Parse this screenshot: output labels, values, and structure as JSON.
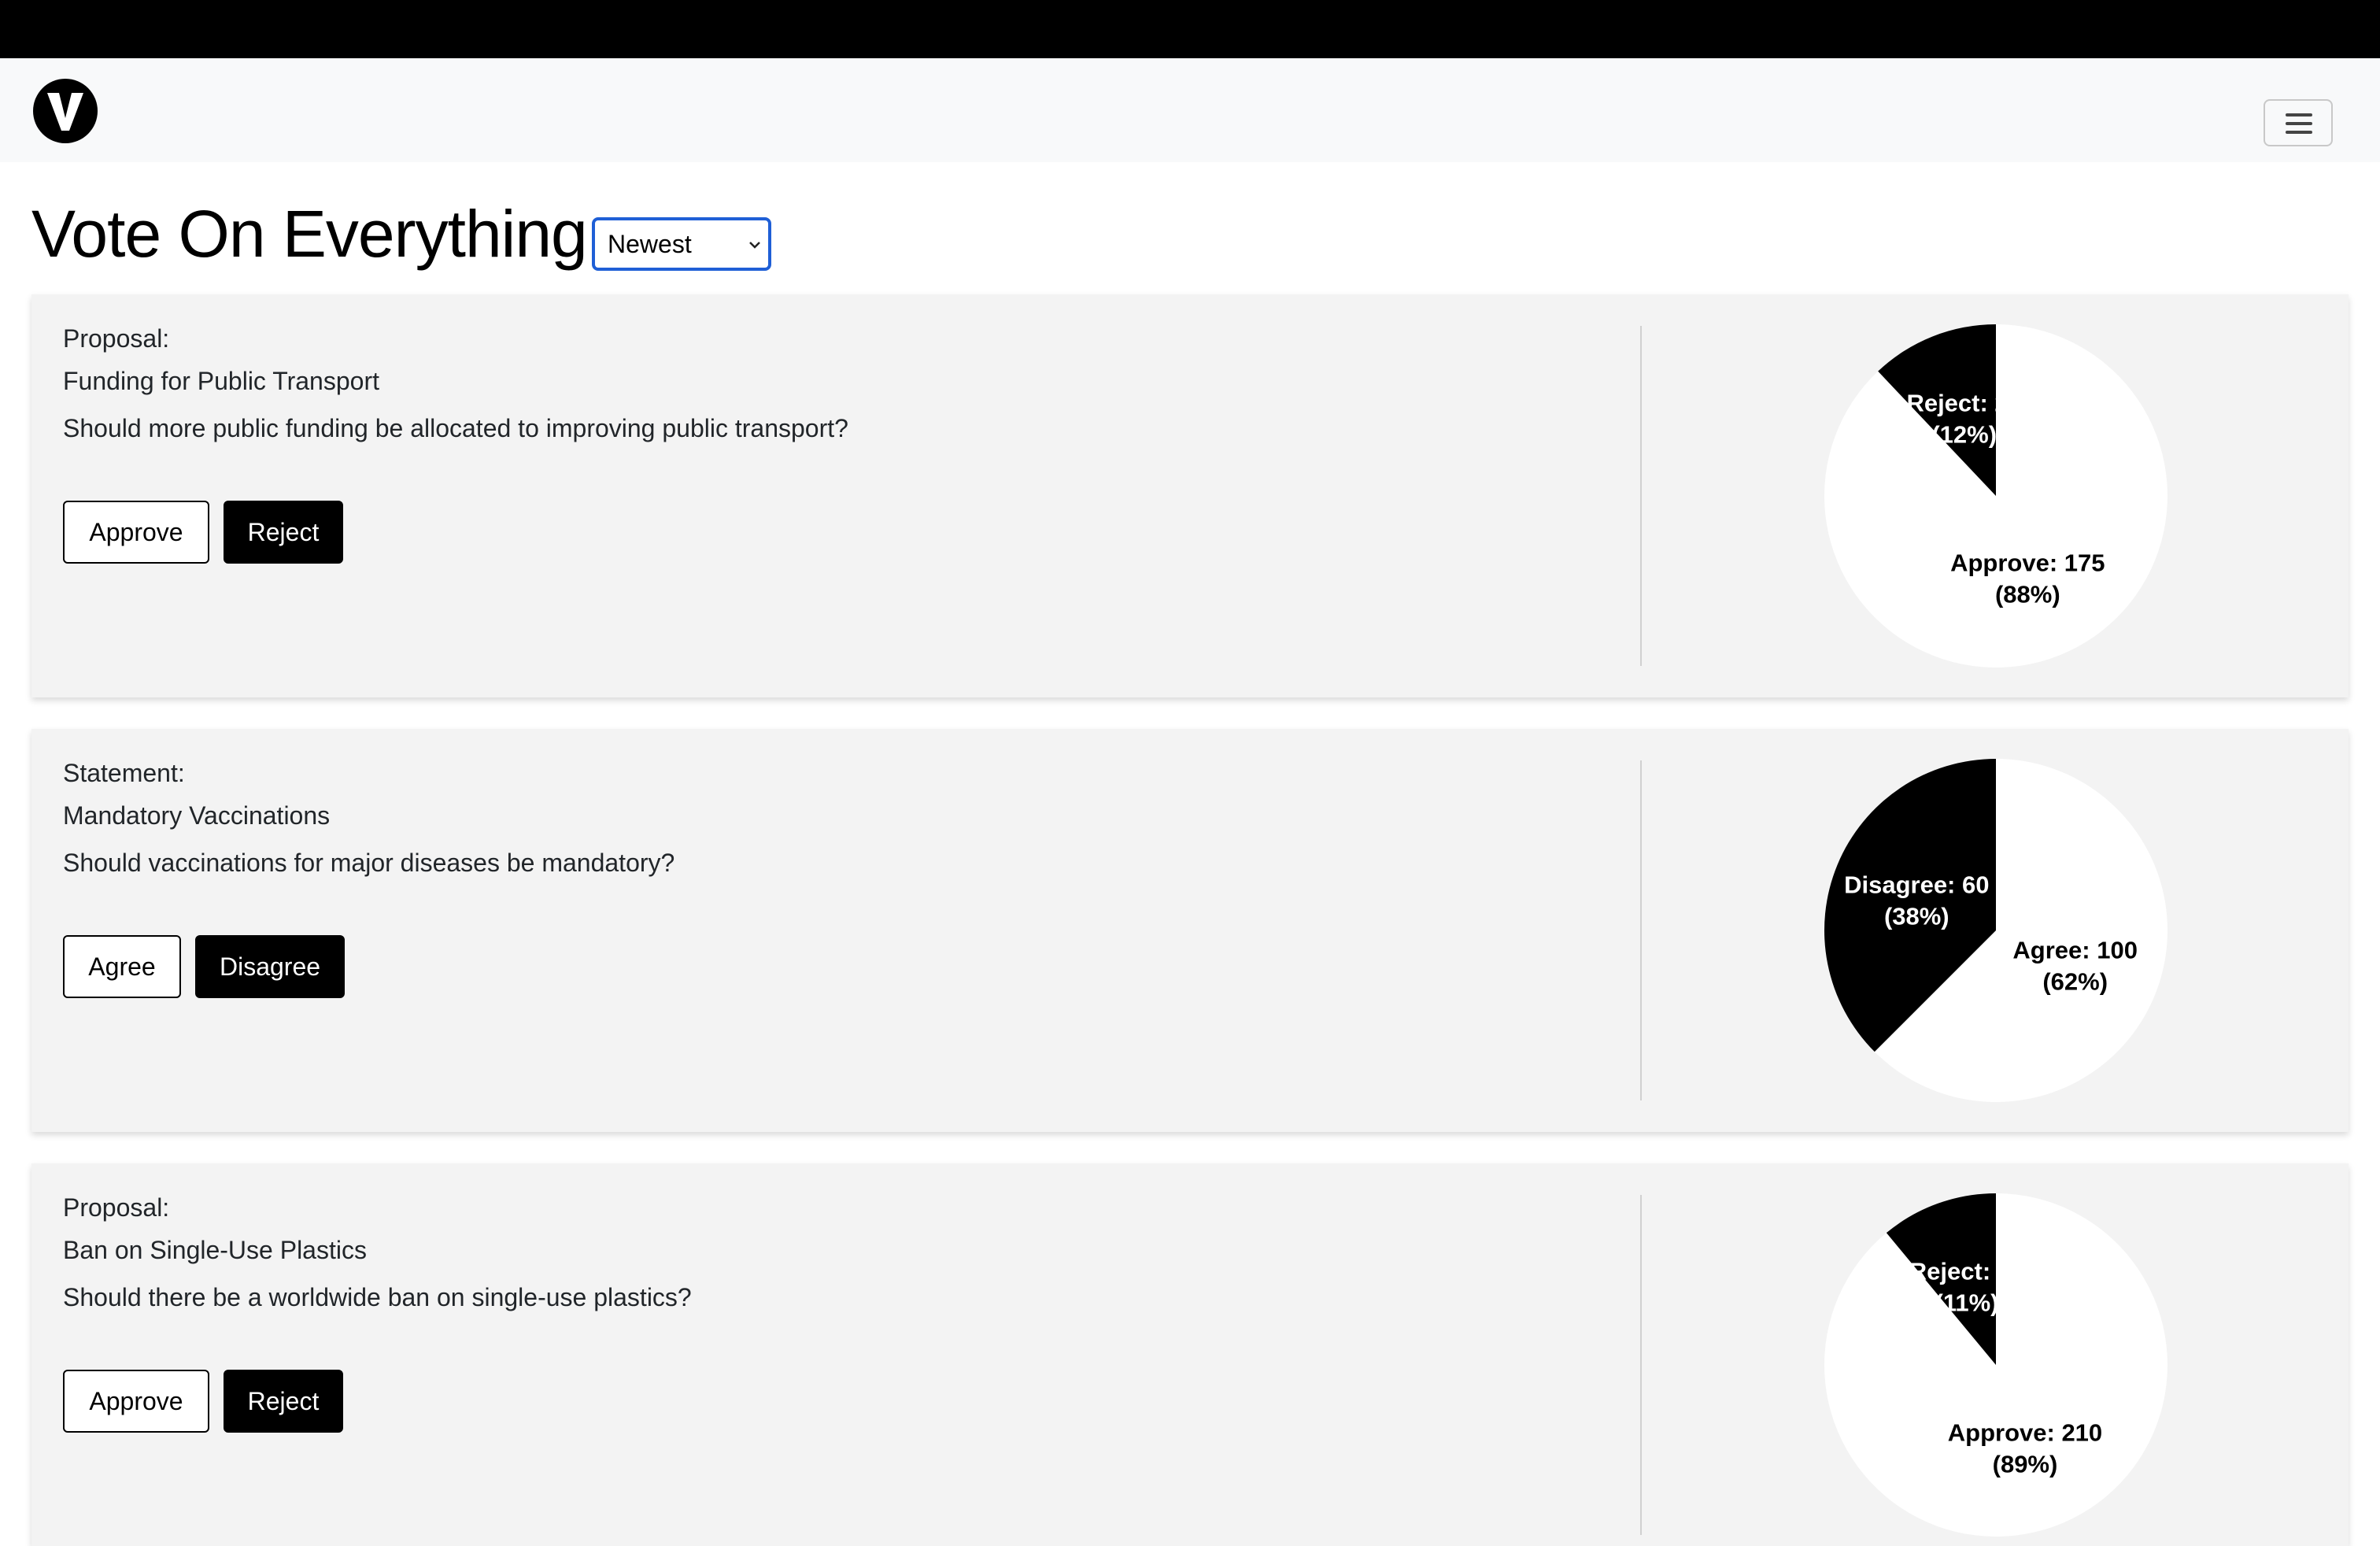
{
  "header": {
    "title": "Vote On Everything.",
    "logo_letter": "V",
    "sort": {
      "selected": "Newest"
    }
  },
  "colors": {
    "accent": "#000000",
    "card_bg": "#f3f3f3",
    "select_border": "#1f5fd6",
    "navbar_bg": "#f8f9fa"
  },
  "cards": [
    {
      "type": "Proposal:",
      "title": "Funding for Public Transport",
      "question": "Should more public funding be allocated to improving public transport?",
      "buttons": [
        "Approve",
        "Reject"
      ],
      "results": [
        {
          "label": "Approve",
          "value": 175,
          "percent": "88%"
        },
        {
          "label": "Reject",
          "value": 24,
          "percent": "12%"
        }
      ]
    },
    {
      "type": "Statement:",
      "title": "Mandatory Vaccinations",
      "question": "Should vaccinations for major diseases be mandatory?",
      "buttons": [
        "Agree",
        "Disagree"
      ],
      "results": [
        {
          "label": "Agree",
          "value": 100,
          "percent": "62%"
        },
        {
          "label": "Disagree",
          "value": 60,
          "percent": "38%"
        }
      ]
    },
    {
      "type": "Proposal:",
      "title": "Ban on Single-Use Plastics",
      "question": "Should there be a worldwide ban on single-use plastics?",
      "buttons": [
        "Approve",
        "Reject"
      ],
      "results": [
        {
          "label": "Approve",
          "value": 210,
          "percent": "89%"
        },
        {
          "label": "Reject",
          "value": 26,
          "percent": "11%"
        }
      ]
    }
  ],
  "chart_data": [
    {
      "type": "pie",
      "categories": [
        "Approve",
        "Reject"
      ],
      "values": [
        175,
        24
      ],
      "labels": [
        "Approve: 175 (88%)",
        "Reject: 24 (12%)"
      ]
    },
    {
      "type": "pie",
      "categories": [
        "Agree",
        "Disagree"
      ],
      "values": [
        100,
        60
      ],
      "labels": [
        "Agree: 100 (62%)",
        "Disagree: 60 (38%)"
      ]
    },
    {
      "type": "pie",
      "categories": [
        "Approve",
        "Reject"
      ],
      "values": [
        210,
        26
      ],
      "labels": [
        "Approve: 210 (89%)",
        "Reject: 26 (11%)"
      ]
    }
  ]
}
